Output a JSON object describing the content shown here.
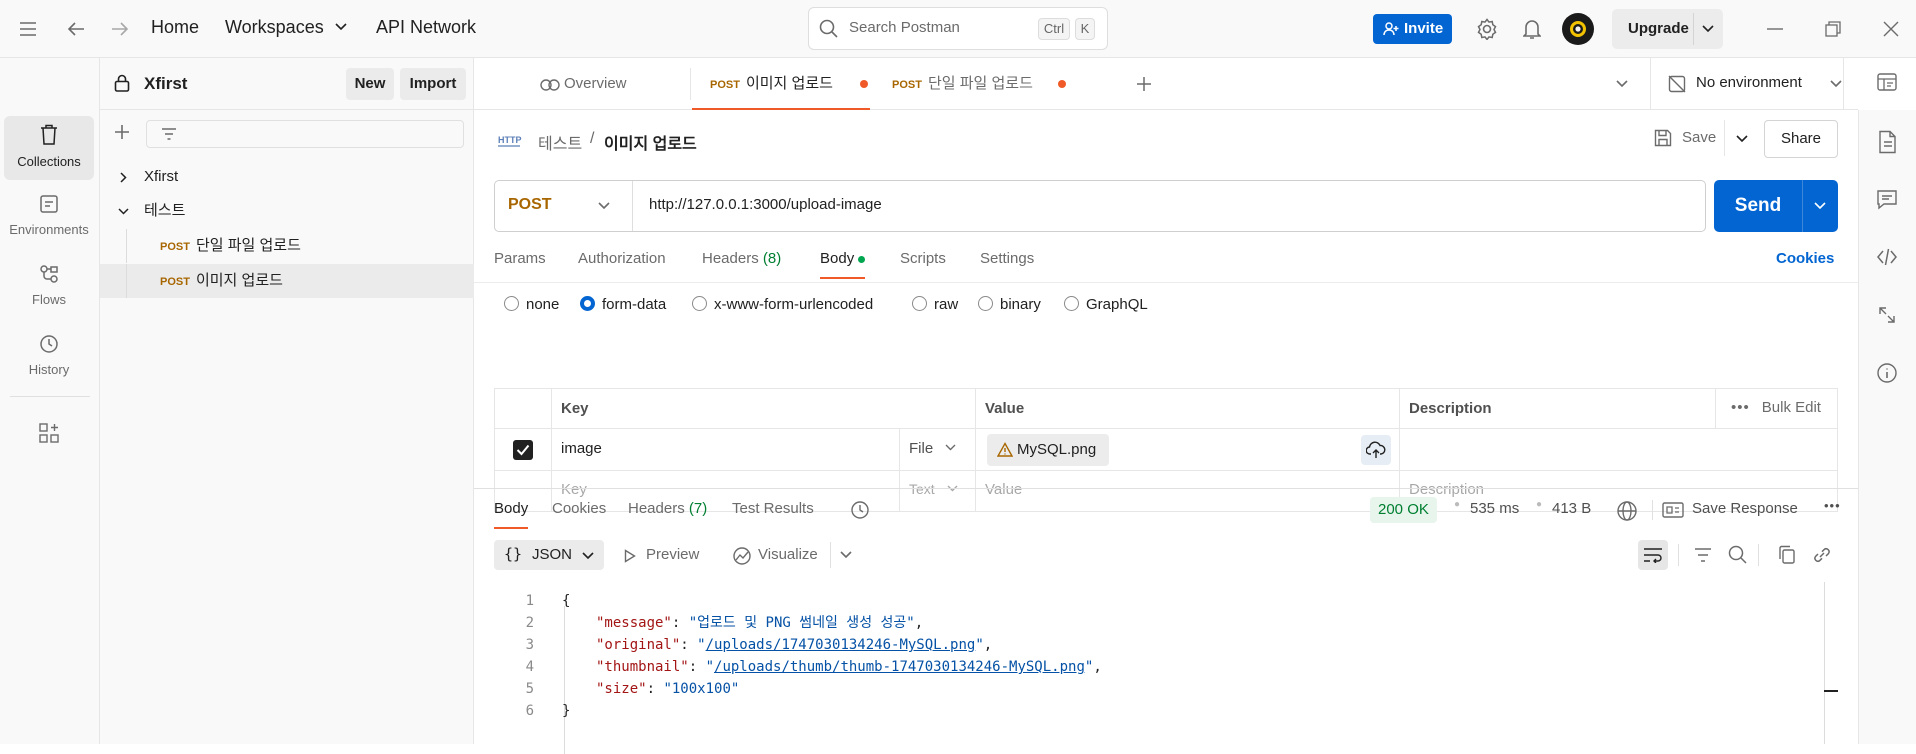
{
  "topbar": {
    "home": "Home",
    "workspaces": "Workspaces",
    "api_network": "API Network",
    "search_placeholder": "Search Postman",
    "shortcut_ctrl": "Ctrl",
    "shortcut_k": "K",
    "invite": "Invite",
    "upgrade": "Upgrade"
  },
  "left_nav": {
    "items": [
      {
        "label": "Collections",
        "icon": "trash-bin-icon",
        "active": true
      },
      {
        "label": "Environments",
        "icon": "environment-icon"
      },
      {
        "label": "Flows",
        "icon": "flows-icon"
      },
      {
        "label": "History",
        "icon": "history-icon"
      }
    ]
  },
  "sidebar": {
    "workspace_name": "Xfirst",
    "new_label": "New",
    "import_label": "Import",
    "tree": [
      {
        "label": "Xfirst",
        "type": "collection",
        "expanded": false
      },
      {
        "label": "테스트",
        "type": "folder",
        "expanded": true
      },
      {
        "method": "POST",
        "label": "단일 파일 업로드",
        "type": "request"
      },
      {
        "method": "POST",
        "label": "이미지 업로드",
        "type": "request",
        "selected": true
      }
    ]
  },
  "tabs": [
    {
      "label": "Overview"
    },
    {
      "method": "POST",
      "label": "이미지 업로드",
      "active": true,
      "unsaved": true
    },
    {
      "method": "POST",
      "label": "단일 파일 업로드",
      "unsaved": true
    }
  ],
  "environment": "No environment",
  "request": {
    "breadcrumb_parent": "테스트",
    "breadcrumb_sep": "/",
    "breadcrumb_name": "이미지 업로드",
    "save_label": "Save",
    "share_label": "Share",
    "method": "POST",
    "url": "http://127.0.0.1:3000/upload-image",
    "send_label": "Send",
    "tabs": {
      "params": "Params",
      "authorization": "Authorization",
      "headers": "Headers",
      "headers_count": "(8)",
      "body": "Body",
      "scripts": "Scripts",
      "settings": "Settings",
      "cookies": "Cookies"
    },
    "body_modes": [
      "none",
      "form-data",
      "x-www-form-urlencoded",
      "raw",
      "binary",
      "GraphQL"
    ],
    "body_mode_selected": "form-data",
    "table": {
      "headers": {
        "key": "Key",
        "value": "Value",
        "description": "Description",
        "bulk_edit": "Bulk Edit"
      },
      "row": {
        "key": "image",
        "type": "File",
        "value": "MySQL.png",
        "checked": true
      },
      "placeholder": {
        "key": "Key",
        "type": "Text",
        "value": "Value",
        "description": "Description"
      }
    }
  },
  "response": {
    "tabs": {
      "body": "Body",
      "cookies": "Cookies",
      "headers": "Headers",
      "headers_count": "(7)",
      "test_results": "Test Results"
    },
    "status": "200 OK",
    "time": "535 ms",
    "size": "413 B",
    "save_response": "Save Response",
    "format": "JSON",
    "preview": "Preview",
    "visualize": "Visualize",
    "lines": [
      {
        "n": "1",
        "text": "{"
      },
      {
        "n": "2",
        "key": "\"message\"",
        "value": "\"업로드 및 PNG 썸네일 생성 성공\""
      },
      {
        "n": "3",
        "key": "\"original\"",
        "value": "/uploads/1747030134246-MySQL.png"
      },
      {
        "n": "4",
        "key": "\"thumbnail\"",
        "value": "/uploads/thumb/thumb-1747030134246-MySQL.png"
      },
      {
        "n": "5",
        "key": "\"size\"",
        "value": "\"100x100\""
      },
      {
        "n": "6",
        "text": "}"
      }
    ]
  },
  "colors": {
    "accent": "#0265d2",
    "post_method": "#a86600",
    "unsaved_dot": "#f05a28",
    "status_ok": "#007f31",
    "active_tab_underline": "#f05a28"
  }
}
